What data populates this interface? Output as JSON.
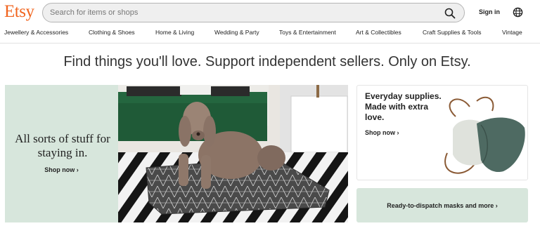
{
  "header": {
    "logo": "Etsy",
    "search_placeholder": "Search for items or shops",
    "sign_in": "Sign in",
    "search_icon": "search-icon",
    "globe_icon": "globe-icon"
  },
  "nav": {
    "items": [
      "Jewellery & Accessories",
      "Clothing & Shoes",
      "Home & Living",
      "Wedding & Party",
      "Toys & Entertainment",
      "Art & Collectibles",
      "Craft Supplies & Tools",
      "Vintage"
    ]
  },
  "tagline": "Find things you'll love. Support independent sellers. Only on Etsy.",
  "hero": {
    "title": "All sorts of stuff for staying in.",
    "shop_now": "Shop now",
    "chevron": "›"
  },
  "cards": {
    "supplies": {
      "title": "Everyday supplies. Made with extra love.",
      "shop_now": "Shop now",
      "chevron": "›"
    },
    "masks": {
      "label": "Ready-to-dispatch masks and more",
      "chevron": "›"
    }
  },
  "colors": {
    "brand": "#F1641E",
    "mint": "#D7E6DC",
    "search_bg": "#EFEFEF"
  }
}
